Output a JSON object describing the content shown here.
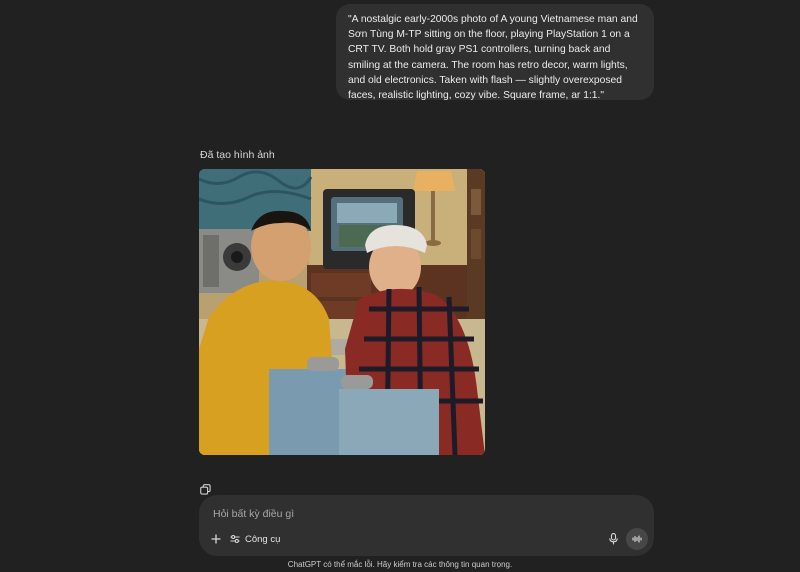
{
  "conversation": {
    "user_prompt": "\"A nostalgic early-2000s photo of A young Vietnamese man and Sơn Tùng M-TP sitting on the floor, playing PlayStation 1 on a CRT TV. Both hold gray PS1 controllers, turning back and smiling at the camera. The room has retro decor, warm lights, and old electronics. Taken with flash — slightly overexposed faces, realistic lighting, cozy vibe. Square frame, ar 1:1.\"",
    "generated_label": "Đã tạo hình ảnh"
  },
  "composer": {
    "placeholder": "Hỏi bất kỳ điều gì",
    "tools_label": "Công cụ"
  },
  "footer": {
    "disclaimer": "ChatGPT có thể mắc lỗi. Hãy kiểm tra các thông tin quan trọng."
  },
  "icons": {
    "copy": "copy-icon",
    "plus": "plus-icon",
    "tools": "sliders-icon",
    "mic": "microphone-icon",
    "voice": "voice-waveform-icon"
  },
  "colors": {
    "background": "#212121",
    "bubble": "#303030",
    "composer": "#303030",
    "voice_button": "#474747"
  }
}
